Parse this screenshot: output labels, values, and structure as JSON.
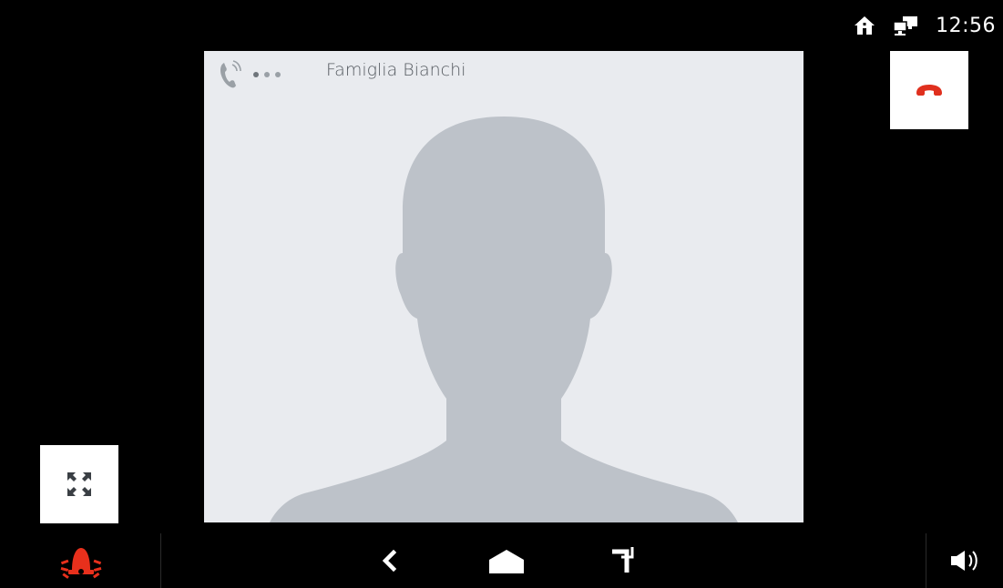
{
  "status_bar": {
    "time": "12:56",
    "icons": [
      "home-icon",
      "network-icon"
    ]
  },
  "call": {
    "caller_name": "Famiglia Bianchi",
    "status_icon": "ringing-phone-icon",
    "avatar": "person-silhouette"
  },
  "controls": {
    "hangup_icon": "hangup-phone-icon",
    "fullscreen_icon": "expand-icon"
  },
  "nav_bar": {
    "items": [
      "alarm-icon",
      "back-icon",
      "home-icon",
      "recents-icon",
      "volume-icon"
    ]
  },
  "colors": {
    "background": "#000000",
    "panel": "#e9ebef",
    "silhouette": "#bdc2c9",
    "hangup": "#e0301e",
    "alarm": "#e8301c",
    "caller_text": "#555a60"
  }
}
